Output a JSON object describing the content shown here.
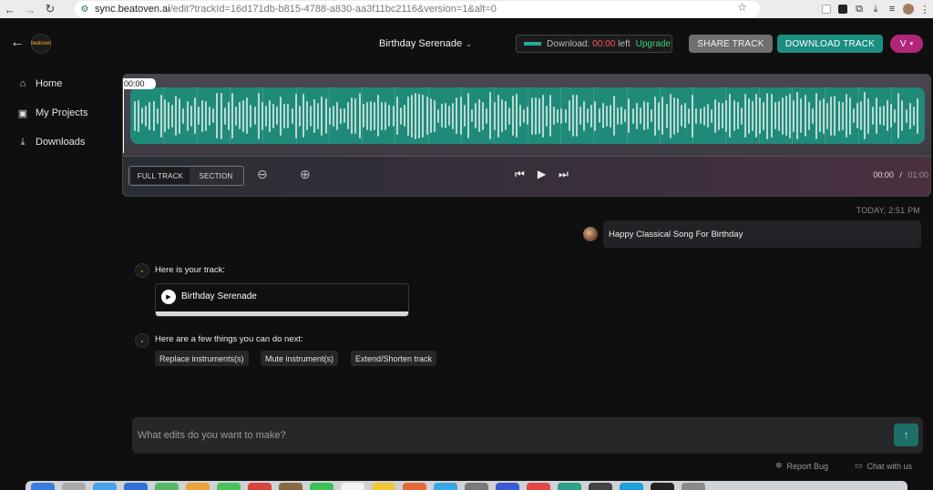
{
  "browser": {
    "url_host": "sync.beatoven.ai",
    "url_path": "/edit?trackId=16d171db-b815-4788-a830-aa3f11bc2116&version=1&alt=0"
  },
  "header": {
    "track_title": "Birthday Serenade",
    "download_label": "Download:",
    "download_time": "00:00",
    "download_left": "left",
    "upgrade": "Upgrade",
    "share_track": "SHARE TRACK",
    "download_track": "DOWNLOAD TRACK",
    "user_initial": "V",
    "logo_text": "beatoven"
  },
  "sidebar": {
    "items": [
      {
        "label": "Home"
      },
      {
        "label": "My Projects"
      },
      {
        "label": "Downloads"
      }
    ]
  },
  "player": {
    "playhead_time": "00:00",
    "mode_full": "FULL TRACK",
    "mode_section": "SECTION",
    "current_time": "00:00",
    "separator": "/",
    "total_time": "01:00"
  },
  "chat": {
    "timestamp": "TODAY, 2:51 PM",
    "user_message": "Happy Classical Song For Birthday",
    "bot_here_is": "Here is your track:",
    "track_name": "Birthday Serenade",
    "bot_next": "Here are a few things you can do next:",
    "suggestions": [
      "Replace instruments(s)",
      "Mute instrument(s)",
      "Extend/Shorten track"
    ]
  },
  "prompt": {
    "placeholder": "What edits do you want to make?"
  },
  "footer": {
    "report_bug": "Report Bug",
    "chat_with_us": "Chat with us"
  },
  "colors": {
    "accent_teal": "#1a8f81",
    "wave_teal": "#1f8a7a",
    "user_pink": "#b2267a",
    "time_red": "#ff5757",
    "upgrade_green": "#38d47a"
  }
}
